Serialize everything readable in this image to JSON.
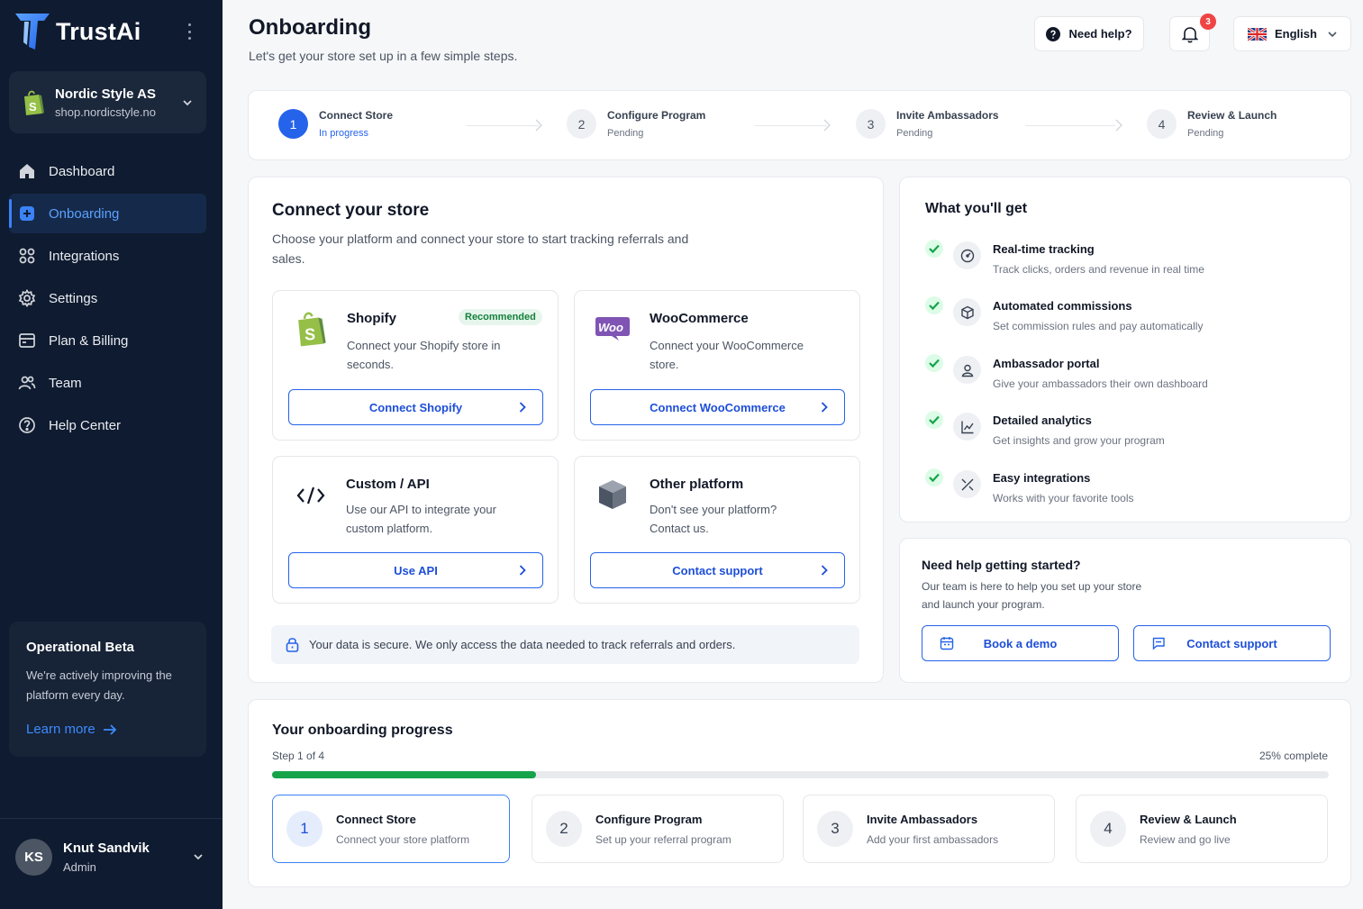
{
  "brand": {
    "name": "TrustAi"
  },
  "store": {
    "name": "Nordic Style AS",
    "url": "shop.nordicstyle.no"
  },
  "sidebar": {
    "items": [
      {
        "label": "Dashboard",
        "icon": "home-icon"
      },
      {
        "label": "Onboarding",
        "icon": "plus-square-icon",
        "active": true
      },
      {
        "label": "Integrations",
        "icon": "grid-icon"
      },
      {
        "label": "Settings",
        "icon": "gear-icon"
      },
      {
        "label": "Plan & Billing",
        "icon": "billing-icon"
      },
      {
        "label": "Team",
        "icon": "users-icon"
      },
      {
        "label": "Help Center",
        "icon": "help-circle-icon"
      }
    ]
  },
  "beta": {
    "title": "Operational Beta",
    "text": "We're actively improving the platform every day.",
    "link": "Learn more"
  },
  "user": {
    "initials": "KS",
    "name": "Knut Sandvik",
    "role": "Admin"
  },
  "header": {
    "title": "Onboarding",
    "subtitle": "Let's get your store set up in a few simple steps.",
    "help_label": "Need help?",
    "notification_count": "3",
    "language": "English"
  },
  "stepper": [
    {
      "num": "1",
      "name": "Connect Store",
      "status": "In progress"
    },
    {
      "num": "2",
      "name": "Configure Program",
      "status": "Pending"
    },
    {
      "num": "3",
      "name": "Invite Ambassadors",
      "status": "Pending"
    },
    {
      "num": "4",
      "name": "Review & Launch",
      "status": "Pending"
    }
  ],
  "connect": {
    "title": "Connect your store",
    "description": "Choose your platform and connect your store to start tracking referrals and sales.",
    "platforms": [
      {
        "name": "Shopify",
        "badge": "Recommended",
        "desc": "Connect your Shopify store in seconds.",
        "button": "Connect Shopify",
        "icon": "shopify-icon"
      },
      {
        "name": "WooCommerce",
        "desc": "Connect your WooCommerce store.",
        "button": "Connect WooCommerce",
        "icon": "woocommerce-icon"
      },
      {
        "name": "Custom / API",
        "desc": "Use our API to integrate your custom platform.",
        "button": "Use API",
        "icon": "code-icon"
      },
      {
        "name": "Other platform",
        "desc": "Don't see your platform? Contact us.",
        "button": "Contact support",
        "icon": "box-icon"
      }
    ],
    "secure_note": "Your data is secure. We only access the data needed to track referrals and orders."
  },
  "benefits": {
    "title": "What you'll get",
    "items": [
      {
        "title": "Real-time tracking",
        "desc": "Track clicks, orders and revenue in real time",
        "icon": "gauge-icon"
      },
      {
        "title": "Automated commissions",
        "desc": "Set commission rules and pay automatically",
        "icon": "cube-icon"
      },
      {
        "title": "Ambassador portal",
        "desc": "Give your ambassadors their own dashboard",
        "icon": "portal-icon"
      },
      {
        "title": "Detailed analytics",
        "desc": "Get insights and grow your program",
        "icon": "analytics-icon"
      },
      {
        "title": "Easy integrations",
        "desc": "Works with your favorite tools",
        "icon": "plug-icon"
      }
    ]
  },
  "help": {
    "title": "Need help getting started?",
    "text": "Our team is here to help you set up your store and launch your program.",
    "demo_button": "Book a demo",
    "support_button": "Contact support"
  },
  "progress": {
    "title": "Your onboarding progress",
    "step_text": "Step 1 of 4",
    "percent_text": "25% complete",
    "percent": 25,
    "steps": [
      {
        "num": "1",
        "title": "Connect Store",
        "desc": "Connect your store platform"
      },
      {
        "num": "2",
        "title": "Configure Program",
        "desc": "Set up your referral program"
      },
      {
        "num": "3",
        "title": "Invite Ambassadors",
        "desc": "Add your first ambassadors"
      },
      {
        "num": "4",
        "title": "Review & Launch",
        "desc": "Review and go live"
      }
    ]
  },
  "colors": {
    "sidebar_bg": "#0f1b30",
    "accent": "#2563eb",
    "success": "#16a34a",
    "notification": "#ef4444"
  }
}
